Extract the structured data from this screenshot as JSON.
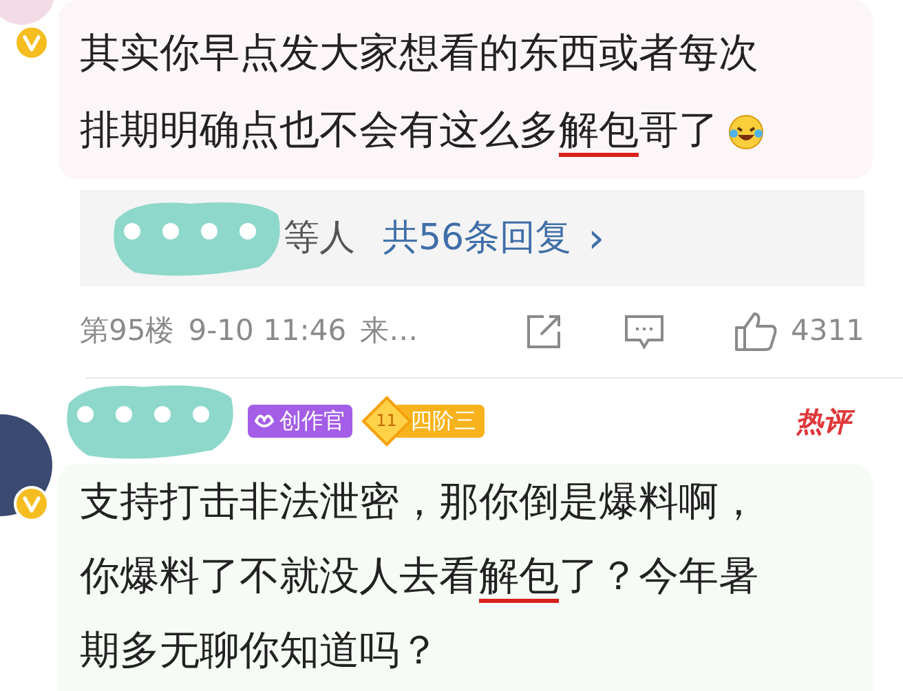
{
  "comments": [
    {
      "verified": true,
      "segments": [
        {
          "text": "其实你早点发大家想看的东西或者每次排期明确点也不会有这么多",
          "marked": false
        },
        {
          "text": "解包",
          "marked": true
        },
        {
          "text": "哥了",
          "marked": false
        }
      ],
      "emoji": {
        "kind": "laughing"
      },
      "replies": {
        "names": "等人",
        "count": "共56条回复",
        "arrow": "›"
      },
      "meta": {
        "floor": "第95楼",
        "time": "9-10 11:46",
        "location": "来…"
      },
      "likes": "4311"
    },
    {
      "verified": true,
      "badges": [
        {
          "kind": "creator",
          "label": "创作官"
        },
        {
          "kind": "level",
          "level_text": "11",
          "label": "四阶三"
        }
      ],
      "hot": "热评",
      "segments": [
        {
          "text": "支持打击非法泄密，那你倒是爆料啊，你爆料了不就没人去看",
          "marked": false
        },
        {
          "text": "解包",
          "marked": true
        },
        {
          "text": "了？今年暑期多无聊你知道吗？",
          "marked": false
        }
      ],
      "hot_shown": true
    }
  ]
}
